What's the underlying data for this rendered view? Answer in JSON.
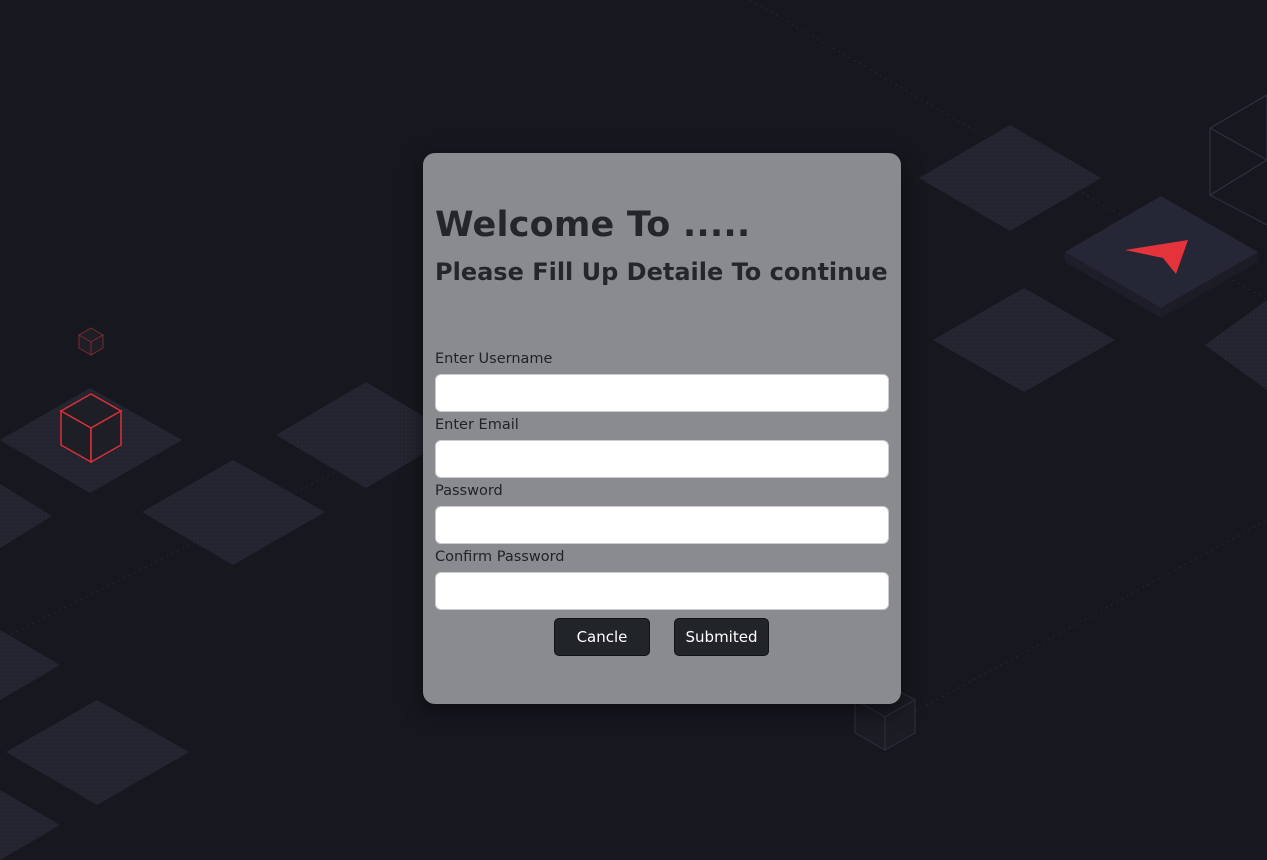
{
  "form": {
    "title": "Welcome To .....",
    "subtitle": "Please Fill Up Detaile To continue",
    "fields": [
      {
        "label": "Enter Username",
        "value": "",
        "placeholder": ""
      },
      {
        "label": "Enter Email",
        "value": "",
        "placeholder": ""
      },
      {
        "label": "Password",
        "value": "",
        "placeholder": ""
      },
      {
        "label": "Confirm Password",
        "value": "",
        "placeholder": ""
      }
    ],
    "cancel_label": "Cancle",
    "submit_label": "Submited"
  },
  "colors": {
    "background": "#17171f",
    "tile": "#23242f",
    "card": "#8a8b8f",
    "button": "#212428",
    "accent_red": "#e5333b"
  },
  "icons": {
    "logo": "red-arrow-logo-icon",
    "decor": "isometric-cube-icon"
  }
}
